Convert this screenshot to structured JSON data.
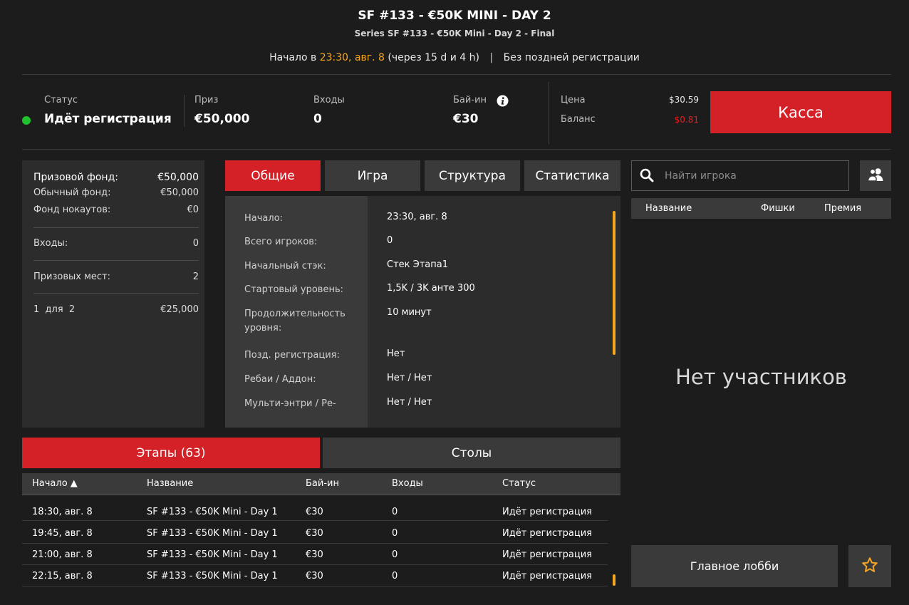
{
  "header": {
    "title": "SF #133 - €50K MINI - DAY 2",
    "subtitle": "Series SF #133 - €50K Mini - Day 2 - Final",
    "start_prefix": "Начало в",
    "start_time": "23:30, авг. 8",
    "start_countdown": "(через 15 d и 4 h)",
    "separator": "|",
    "late_reg": "Без поздней регистрации"
  },
  "stats": {
    "status_label": "Статус",
    "status_value": "Идёт регистрация",
    "status_color": "#1fc12c",
    "prize_label": "Приз",
    "prize_value": "€50,000",
    "entries_label": "Входы",
    "entries_value": "0",
    "buyin_label": "Бай-ин",
    "buyin_value": "€30",
    "price_label": "Цена",
    "price_value": "$30.59",
    "balance_label": "Баланс",
    "balance_value": "$0.81",
    "balance_color": "#e02020",
    "cashier_label": "Касса",
    "info_icon": "info-icon"
  },
  "prize_panel": {
    "pool_label": "Призовой фонд:",
    "pool_value": "€50,000",
    "regular_label": "Обычный фонд:",
    "regular_value": "€50,000",
    "knockout_label": "Фонд нокаутов:",
    "knockout_value": "€0",
    "entries_label": "Входы:",
    "entries_value": "0",
    "paid_label": "Призовых мест:",
    "paid_value": "2",
    "place_label": "1  для  2",
    "place_value": "€25,000"
  },
  "tabs": [
    "Общие",
    "Игра",
    "Структура",
    "Статистика"
  ],
  "info": [
    {
      "key": "Начало:",
      "value": "23:30, авг. 8"
    },
    {
      "key": "Всего игроков:",
      "value": "0"
    },
    {
      "key": "Начальный стэк:",
      "value": "Стек Этапа1"
    },
    {
      "key": "Стартовый уровень:",
      "value": "1,5K / 3K анте 300"
    },
    {
      "key": "Продолжительность уровня:",
      "value": "10 минут"
    },
    {
      "key": "Позд. регистрация:",
      "value": "Нет"
    },
    {
      "key": "Ребаи / Аддон:",
      "value": "Нет / Нет"
    },
    {
      "key": "Мульти-энтри / Ре-",
      "value": "Нет / Нет"
    }
  ],
  "bottom_tabs": {
    "stages": "Этапы (63)",
    "tables": "Столы"
  },
  "stages_table": {
    "columns": [
      "Начало ▲",
      "Название",
      "Бай-ин",
      "Входы",
      "Статус"
    ],
    "rows": [
      [
        "18:30, авг. 8",
        "SF #133 - €50K Mini - Day 1",
        "€30",
        "0",
        "Идёт регистрация"
      ],
      [
        "19:45, авг. 8",
        "SF #133 - €50K Mini - Day 1",
        "€30",
        "0",
        "Идёт регистрация"
      ],
      [
        "21:00, авг. 8",
        "SF #133 - €50K Mini - Day 1",
        "€30",
        "0",
        "Идёт регистрация"
      ],
      [
        "22:15, авг. 8",
        "SF #133 - €50K Mini - Day 1",
        "€30",
        "0",
        "Идёт регистрация"
      ]
    ]
  },
  "players": {
    "search_placeholder": "Найти игрока",
    "columns": [
      "Название",
      "Фишки",
      "Премия"
    ],
    "empty_text": "Нет участников"
  },
  "footer": {
    "main_lobby": "Главное лобби"
  },
  "colors": {
    "accent_red": "#d42127",
    "accent_orange": "#f5a623",
    "panel": "#2c2c2c",
    "panel_light": "#3a3a3a"
  }
}
